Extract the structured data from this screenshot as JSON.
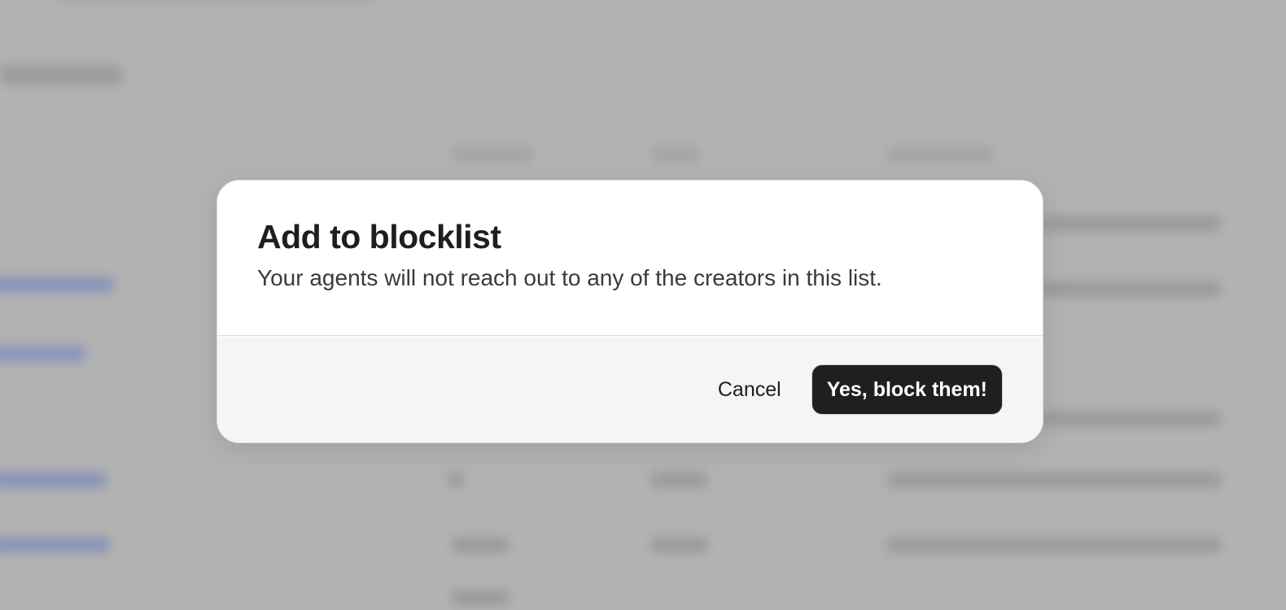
{
  "dialog": {
    "title": "Add to blocklist",
    "description": "Your agents will not reach out to any of the creators in this list.",
    "cancel_label": "Cancel",
    "confirm_label": "Yes, block them!"
  },
  "colors": {
    "overlay": "#b2b2b2",
    "dialog_bg": "#ffffff",
    "footer_bg": "#f6f5f4",
    "confirm_bg": "#1f1f1f",
    "confirm_text": "#ffffff",
    "title_text": "#1e1e1e"
  }
}
